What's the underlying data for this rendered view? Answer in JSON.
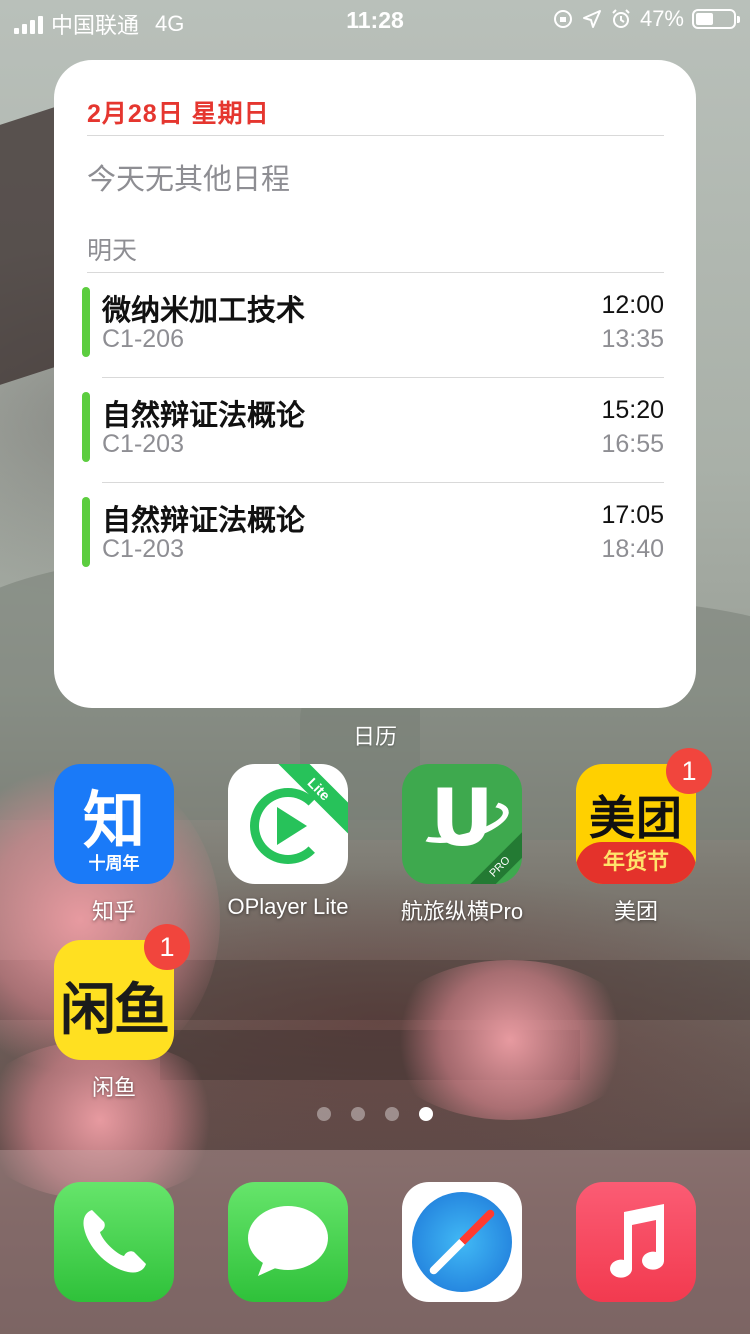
{
  "status_bar": {
    "carrier": "中国联通",
    "network": "4G",
    "time": "11:28",
    "battery": "47%",
    "battery_level": 0.47,
    "icons": [
      "signal-icon",
      "lock-rotation-icon",
      "location-icon",
      "alarm-icon",
      "battery-icon"
    ]
  },
  "widget": {
    "date": "2月28日 星期日",
    "no_events_today": "今天无其他日程",
    "tomorrow_label": "明天",
    "events": [
      {
        "title": "微纳米加工技术",
        "room": "C1-206",
        "start": "12:00",
        "end": "13:35",
        "color": "#5ccd3f"
      },
      {
        "title": "自然辩证法概论",
        "room": "C1-203",
        "start": "15:20",
        "end": "16:55",
        "color": "#5ccd3f"
      },
      {
        "title": "自然辩证法概论",
        "room": "C1-203",
        "start": "17:05",
        "end": "18:40",
        "color": "#5ccd3f"
      }
    ],
    "label": "日历"
  },
  "apps": [
    {
      "label": "知乎",
      "icon_text": "知",
      "icon_sub": "十周年"
    },
    {
      "label": "OPlayer Lite",
      "icon_tag": "Lite"
    },
    {
      "label": "航旅纵横Pro",
      "icon_text": "U",
      "icon_tag": "PRO"
    },
    {
      "label": "美团",
      "icon_text": "美团",
      "icon_sub": "年货节",
      "badge": "1"
    },
    {
      "label": "闲鱼",
      "icon_text": "闲鱼",
      "badge": "1"
    }
  ],
  "page_dots": {
    "count": 4,
    "active_index": 3
  },
  "dock": [
    "phone-icon",
    "messages-icon",
    "safari-icon",
    "music-icon"
  ],
  "colors": {
    "calendar_red": "#e5362f",
    "event_green": "#5ccd3f",
    "badge_red": "#f1453d"
  }
}
